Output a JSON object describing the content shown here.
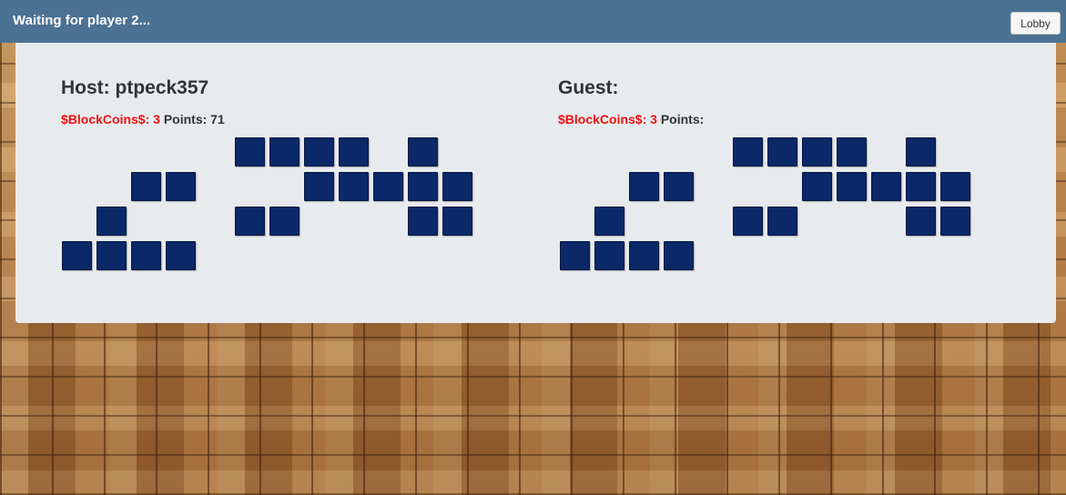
{
  "header": {
    "title": "Waiting for player 2...",
    "lobby_label": "Lobby"
  },
  "host": {
    "name_text": "Host: ptpeck357",
    "coins_text": "$BlockCoins$: 3",
    "points_text": "Points: 71"
  },
  "guest": {
    "name_text": "Guest:",
    "coins_text": "$BlockCoins$: 3",
    "points_text": "Points:"
  },
  "colors": {
    "header_bg": "#4b7193",
    "panel_bg": "#e8ebee",
    "block": "#0b2868",
    "coins": "#ee1111"
  },
  "board_cells": [
    [
      0,
      0,
      0,
      0,
      0,
      1,
      1,
      1,
      1,
      0,
      1,
      0,
      0
    ],
    [
      0,
      0,
      1,
      1,
      0,
      0,
      0,
      1,
      1,
      1,
      1,
      1,
      0
    ],
    [
      0,
      1,
      0,
      0,
      0,
      1,
      1,
      0,
      0,
      0,
      1,
      1,
      0
    ],
    [
      1,
      1,
      1,
      1,
      0,
      0,
      0,
      0,
      0,
      0,
      0,
      0,
      0
    ]
  ]
}
